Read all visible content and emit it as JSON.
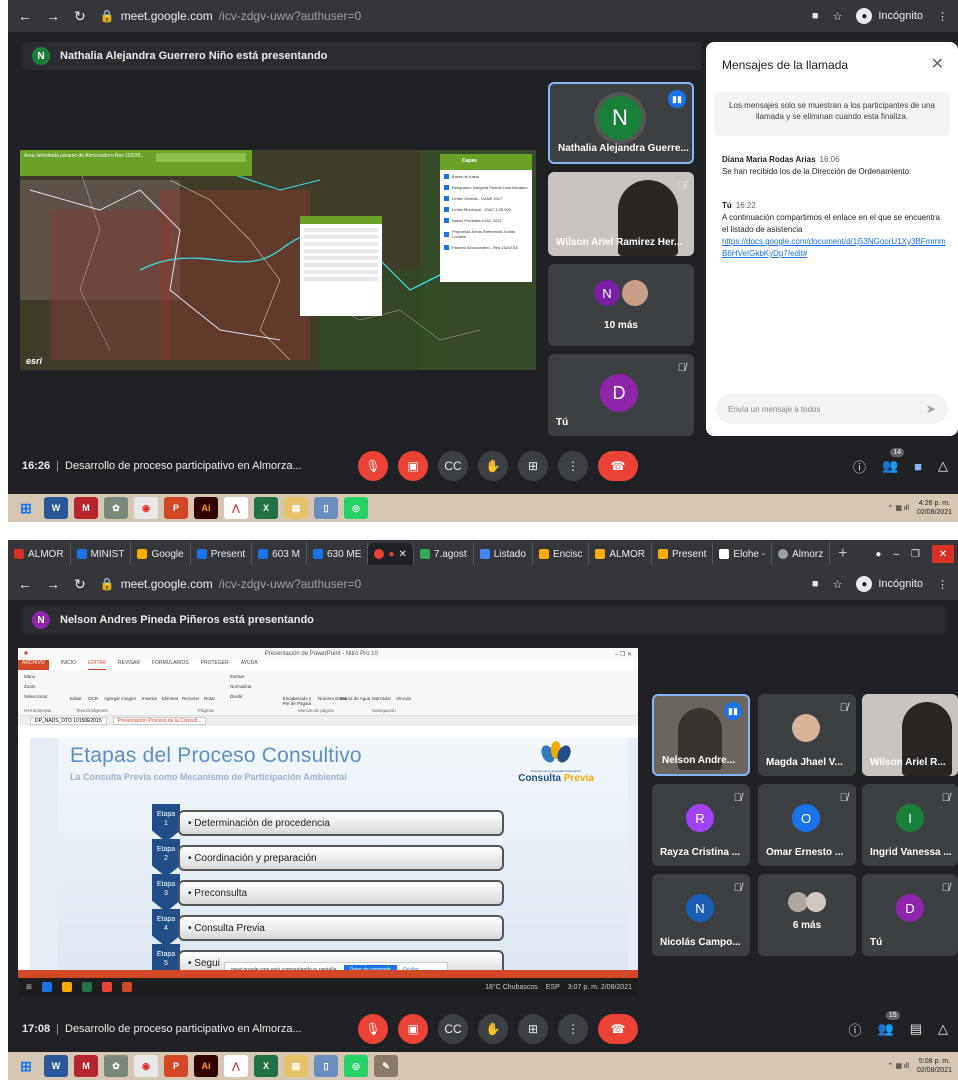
{
  "shot1": {
    "address": {
      "domain": "meet.google.com",
      "path": "/icv-zdgv-uww?authuser=0",
      "incognito": "Incógnito"
    },
    "presenter": {
      "initial": "N",
      "text": "Nathalia Alejandra Guerrero Niño está presentando"
    },
    "map": {
      "toolbar_title": "Área delimitada páramo de Almorzadero Res 152/29...",
      "layers_title": "Capas",
      "layers": [
        "Áreas de trasla",
        "Resguardo Indígena Pueblo Uwa tributario",
        "Límite Veredal - DANE 2017",
        "Límite Municipal - IGAC 1:25.000",
        "Bases Prediales IGAC 2021",
        "Propuesta Áreas Referencia Juntas Locales",
        "Páramo Almorzadero - Res 152/2016"
      ],
      "esri": "esri"
    },
    "tiles": {
      "t1": {
        "initial": "N",
        "name": "Nathalia Alejandra Guerre..."
      },
      "t2": {
        "name": "Wilson Ariel Ramirez Her..."
      },
      "t3": {
        "initial": "N",
        "more": "10 más"
      },
      "t4": {
        "initial": "D",
        "name": "Tú"
      }
    },
    "chat": {
      "title": "Mensajes de la llamada",
      "notice": "Los mensajes solo se muestran a los participantes de una llamada y se eliminan cuando esta finaliza.",
      "messages": [
        {
          "who": "Diana Maria Rodas Arias",
          "time": "16:06",
          "text": "Se han recibido los de la Dirección de Ordenamiento"
        },
        {
          "who": "Tú",
          "time": "16:22",
          "text": "A continuación compartimos el enlace en el que se encuentra el listado de asistencia",
          "link": "https://docs.google.com/document/d/1j53NGoorU1Xy3BFmmmB6HVeIGkbKyDp7/edit#"
        }
      ],
      "placeholder": "Envía un mensaje a todos"
    },
    "controls": {
      "clock": "16:26",
      "meeting": "Desarrollo de proceso participativo en Almorza...",
      "people_count": "14"
    },
    "taskbar": {
      "time": "4:26 p. m.",
      "date": "02/08/2021"
    }
  },
  "shot2": {
    "tabs": [
      "ALMOR",
      "MINIST",
      "Google",
      "Present",
      "603 M",
      "630 ME",
      "",
      "7.agost",
      "Listado",
      "Encisc",
      "ALMOR",
      "Present",
      "Elohe -",
      "Almorz"
    ],
    "tab_colors": [
      "#d93025",
      "#1a73e8",
      "#f9ab00",
      "#1a73e8",
      "#1a73e8",
      "#1a73e8",
      "#ea4335",
      "#34a853",
      "#4285f4",
      "#f9ab00",
      "#f9ab00",
      "#f9ab00",
      "#4285f4",
      "#9aa0a6"
    ],
    "address": {
      "domain": "meet.google.com",
      "path": "/icv-zdgv-uww?authuser=0",
      "incognito": "Incógnito"
    },
    "presenter": {
      "initial": "N",
      "text": "Nelson Andres Pineda Piñeros está presentando"
    },
    "ppt": {
      "window_title": "Presentación de PowerPoint - Nitro Pro 10",
      "tabs": [
        "ARCHIVO",
        "INICIO",
        "EDITAR",
        "REVISAR",
        "FORMULARIOS",
        "PROTEGER",
        "AYUDA"
      ],
      "ribbon": [
        "Mano",
        "Zoom",
        "Seleccionar",
        "Editar",
        "OCR",
        "Agregar imagen",
        "Insertar",
        "Eliminar",
        "Recortar",
        "Rotar",
        "Extraer",
        "Normalizar",
        "Dividir",
        "Encabezado y Pie de Página",
        "Número Bates",
        "Marca de Agua",
        "Marcador",
        "Vínculo"
      ],
      "groups": [
        "Herramientas",
        "Texto/Imágenes",
        "Páginas",
        "Marcas de página",
        "Navegación"
      ],
      "doctabs": [
        "DP_NADS_DTO 10150E2015",
        "Presentación Proceso de la Consult..."
      ],
      "slide": {
        "title": "Etapas del Proceso Consultivo",
        "subtitle": "La Consulta Previa como Mecanismo de Participación Ambiental",
        "logo_small": "Dirección de la Autoridad Nacional de",
        "logo_brand_a": "Consulta ",
        "logo_brand_b": "Previa",
        "stage_word": "Etapa",
        "stages": [
          {
            "n": "1",
            "text": "• Determinación de procedencia"
          },
          {
            "n": "2",
            "text": "• Coordinación y preparación"
          },
          {
            "n": "3",
            "text": "• Preconsulta"
          },
          {
            "n": "4",
            "text": "• Consulta Previa"
          },
          {
            "n": "5",
            "text": "• Segui"
          }
        ]
      },
      "share": {
        "text": "meet.google.com está compartiendo tu pantalla.",
        "stop": "Dejar de compartir",
        "hide": "Ocultar"
      },
      "inner_taskbar": {
        "weather": "18°C Chubascos",
        "lang": "ESP",
        "time": "3:07 p. m.",
        "date": "2/08/2021"
      }
    },
    "tiles": [
      {
        "name": "Nelson Andre...",
        "kind": "photo",
        "speaking": true
      },
      {
        "name": "Magda Jhael V...",
        "kind": "photo"
      },
      {
        "name": "Wilson Ariel R...",
        "kind": "photo"
      },
      {
        "name": "Rayza Cristina ...",
        "initial": "R",
        "color": "#a142f4"
      },
      {
        "name": "Omar Ernesto ...",
        "initial": "O",
        "color": "#1a73e8"
      },
      {
        "name": "Ingrid Vanessa ...",
        "initial": "I",
        "color": "#188038"
      },
      {
        "name": "Nicolás Campo...",
        "initial": "N",
        "color": "#1a5fb4"
      },
      {
        "name": "6 más",
        "kind": "more"
      },
      {
        "name": "Tú",
        "initial": "D",
        "color": "#8e24aa"
      }
    ],
    "controls": {
      "clock": "17:08",
      "meeting": "Desarrollo de proceso participativo en Almorza...",
      "people_count": "15"
    },
    "taskbar": {
      "time": "5:08 p. m.",
      "date": "02/08/2021"
    }
  }
}
